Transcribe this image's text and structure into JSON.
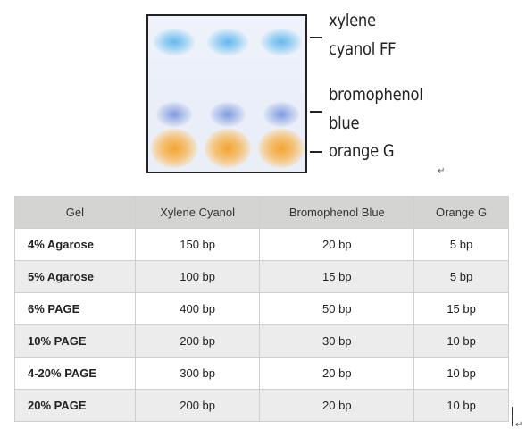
{
  "gel_image": {
    "labels": {
      "xylene_line1": "xylene",
      "xylene_line2": "cyanol FF",
      "bromo_line1": "bromophenol",
      "bromo_line2": "blue",
      "orange": "orange G"
    },
    "colors": {
      "xylene_cyanol": "#62b4eb",
      "bromophenol_blue": "#6e8cdc",
      "orange_g": "#f5a028"
    }
  },
  "paragraph_mark": "↵",
  "table": {
    "headers": [
      "Gel",
      "Xylene Cyanol",
      "Bromophenol Blue",
      "Orange G"
    ],
    "rows": [
      {
        "gel": "4% Agarose",
        "xylene": "150 bp",
        "bromo": "20 bp",
        "orange": "5 bp"
      },
      {
        "gel": "5% Agarose",
        "xylene": "100 bp",
        "bromo": "15 bp",
        "orange": "5 bp"
      },
      {
        "gel": "6% PAGE",
        "xylene": "400 bp",
        "bromo": "50 bp",
        "orange": "15 bp"
      },
      {
        "gel": "10% PAGE",
        "xylene": "200 bp",
        "bromo": "30 bp",
        "orange": "10 bp"
      },
      {
        "gel": "4-20% PAGE",
        "xylene": "300 bp",
        "bromo": "20 bp",
        "orange": "10 bp"
      },
      {
        "gel": "20% PAGE",
        "xylene": "200 bp",
        "bromo": "20 bp",
        "orange": "10 bp"
      }
    ]
  }
}
